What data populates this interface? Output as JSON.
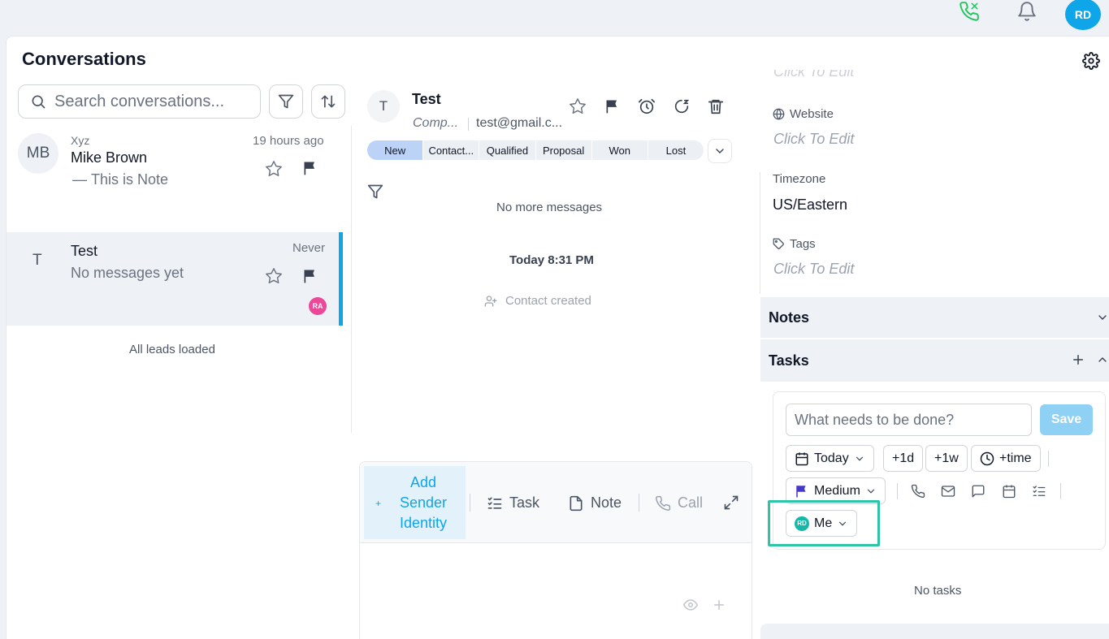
{
  "topbar": {
    "avatar_initials": "RD"
  },
  "sidebar": {
    "title": "Conversations",
    "search_placeholder": "Search conversations...",
    "conversations": [
      {
        "initials": "MB",
        "company": "Xyz",
        "name": "Mike Brown",
        "preview_prefix": "—",
        "preview": "This is Note",
        "time": "19 hours ago"
      },
      {
        "initials": "T",
        "name": "Test",
        "preview": "No messages yet",
        "time": "Never",
        "assignee": "RA"
      }
    ],
    "footer": "All leads loaded"
  },
  "thread": {
    "contact_initial": "T",
    "contact_name": "Test",
    "company": "Comp...",
    "email": "test@gmail.c...",
    "stages": [
      "New",
      "Contact...",
      "Qualified",
      "Proposal",
      "Won",
      "Lost"
    ],
    "active_stage": "New",
    "no_more": "No more messages",
    "date_label": "Today 8:31 PM",
    "event": "Contact created"
  },
  "composer": {
    "add_sender": "Add Sender Identity",
    "task": "Task",
    "note": "Note",
    "call": "Call"
  },
  "details": {
    "partial_top": "Click To Edit",
    "website_label": "Website",
    "website_value": "Click To Edit",
    "timezone_label": "Timezone",
    "timezone_value": "US/Eastern",
    "tags_label": "Tags",
    "tags_value": "Click To Edit",
    "notes_title": "Notes",
    "tasks_title": "Tasks"
  },
  "task_form": {
    "placeholder": "What needs to be done?",
    "save": "Save",
    "date": "Today",
    "plus1d": "+1d",
    "plus1w": "+1w",
    "time": "+time",
    "priority": "Medium",
    "assignee_initials": "RD",
    "assignee": "Me",
    "empty": "No tasks"
  },
  "colors": {
    "accent": "#0ea5e9",
    "highlight": "#2fc3a8",
    "priority_flag": "#4338ca"
  }
}
